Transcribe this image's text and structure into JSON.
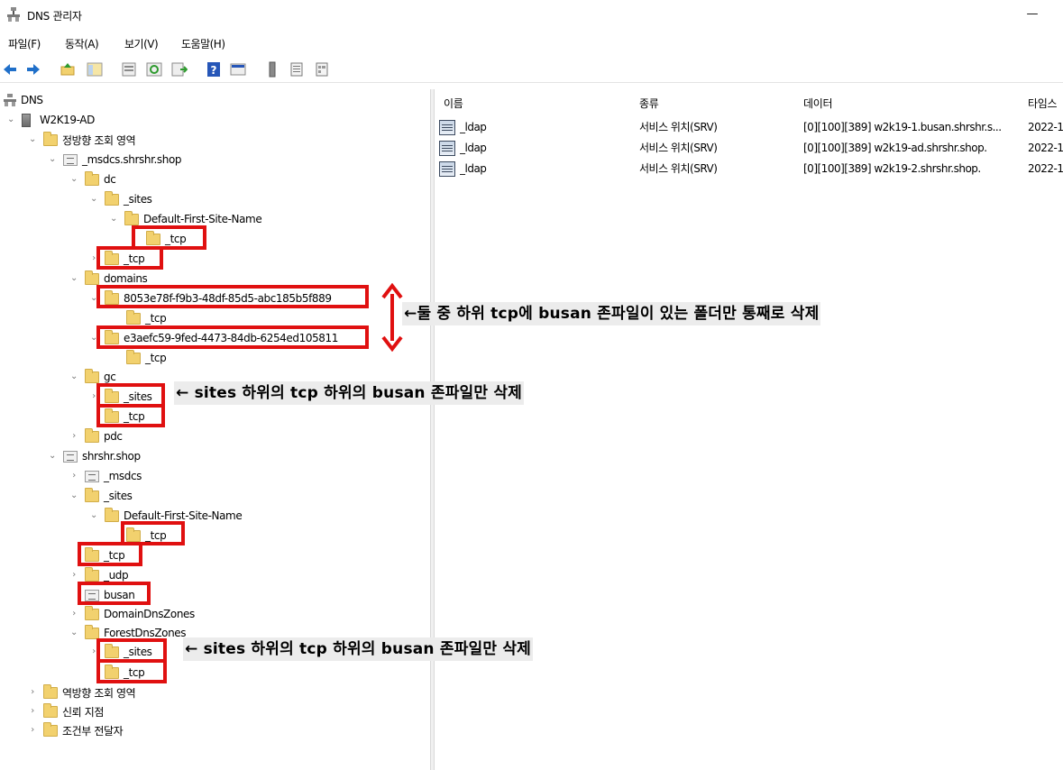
{
  "window": {
    "title": "DNS 관리자",
    "minimize_glyph": "—"
  },
  "menu": [
    "파일(F)",
    "동작(A)",
    "보기(V)",
    "도움말(H)"
  ],
  "toolbar_icons": [
    "back-arrow-icon",
    "forward-arrow-icon",
    "up-folder-icon",
    "show-hide-tree-icon",
    "properties-icon",
    "refresh-icon",
    "export-list-icon",
    "help-icon",
    "console-icon",
    "server-icon",
    "list-icon",
    "details-icon"
  ],
  "tree": {
    "root": "DNS",
    "server": "W2K19-AD",
    "forward_zones": "정방향 조회 영역",
    "msdcs_zone": "_msdcs.shrshr.shop",
    "dc": "dc",
    "dc_sites": "_sites",
    "dc_default_site": "Default-First-Site-Name",
    "dc_site_tcp": "_tcp",
    "dc_tcp": "_tcp",
    "domains": "domains",
    "domain_guid_1": "8053e78f-f9b3-48df-85d5-abc185b5f889",
    "domain_guid_1_tcp": "_tcp",
    "domain_guid_2": "e3aefc59-9fed-4473-84db-6254ed105811",
    "domain_guid_2_tcp": "_tcp",
    "gc": "gc",
    "gc_sites": "_sites",
    "gc_tcp": "_tcp",
    "pdc": "pdc",
    "shop_zone": "shrshr.shop",
    "shop_msdcs": "_msdcs",
    "shop_sites": "_sites",
    "shop_default_site": "Default-First-Site-Name",
    "shop_site_tcp": "_tcp",
    "shop_tcp": "_tcp",
    "shop_udp": "_udp",
    "busan": "busan",
    "domain_dns_zones": "DomainDnsZones",
    "forest_dns_zones": "ForestDnsZones",
    "forest_sites": "_sites",
    "forest_tcp": "_tcp",
    "reverse_zones": "역방향 조회 영역",
    "trust_points": "신뢰 지점",
    "conditional_forwarders": "조건부 전달자"
  },
  "list": {
    "columns": [
      "이름",
      "종류",
      "데이터",
      "타임스"
    ],
    "rows": [
      {
        "name": "_ldap",
        "type": "서비스 위치(SRV)",
        "data": "[0][100][389] w2k19-1.busan.shrshr.s...",
        "timestamp": "2022-1"
      },
      {
        "name": "_ldap",
        "type": "서비스 위치(SRV)",
        "data": "[0][100][389] w2k19-ad.shrshr.shop.",
        "timestamp": "2022-1"
      },
      {
        "name": "_ldap",
        "type": "서비스 위치(SRV)",
        "data": "[0][100][389] w2k19-2.shrshr.shop.",
        "timestamp": "2022-1"
      }
    ]
  },
  "annotations": {
    "domains_note": "←둘 중 하위 tcp에 busan 존파일이 있는 폴더만 통째로 삭제",
    "gc_note": "← sites 하위의 tcp 하위의 busan 존파일만 삭제",
    "forest_note": "← sites 하위의 tcp 하위의 busan 존파일만 삭제"
  },
  "colors": {
    "highlight": "#e01010",
    "folder": "#f2d16e",
    "annotation_bg": "#ececec"
  }
}
